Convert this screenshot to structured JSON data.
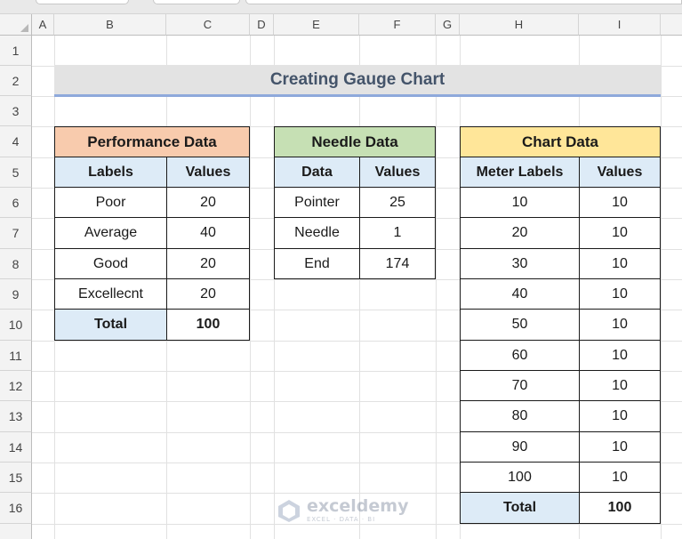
{
  "sheet": {
    "columns": [
      "A",
      "B",
      "C",
      "D",
      "E",
      "F",
      "G",
      "H",
      "I"
    ],
    "rows": [
      "1",
      "2",
      "3",
      "4",
      "5",
      "6",
      "7",
      "8",
      "9",
      "10",
      "11",
      "12",
      "13",
      "14",
      "15",
      "16"
    ]
  },
  "title": "Creating Gauge Chart",
  "performance": {
    "header": "Performance Data",
    "col_labels": "Labels",
    "col_values": "Values",
    "rows": [
      {
        "label": "Poor",
        "value": "20"
      },
      {
        "label": "Average",
        "value": "40"
      },
      {
        "label": "Good",
        "value": "20"
      },
      {
        "label": "Excellecnt",
        "value": "20"
      }
    ],
    "total_label": "Total",
    "total_value": "100"
  },
  "needle": {
    "header": "Needle Data",
    "col_data": "Data",
    "col_values": "Values",
    "rows": [
      {
        "label": "Pointer",
        "value": "25"
      },
      {
        "label": "Needle",
        "value": "1"
      },
      {
        "label": "End",
        "value": "174"
      }
    ]
  },
  "chart": {
    "header": "Chart Data",
    "col_meter": "Meter Labels",
    "col_values": "Values",
    "rows": [
      {
        "label": "10",
        "value": "10"
      },
      {
        "label": "20",
        "value": "10"
      },
      {
        "label": "30",
        "value": "10"
      },
      {
        "label": "40",
        "value": "10"
      },
      {
        "label": "50",
        "value": "10"
      },
      {
        "label": "60",
        "value": "10"
      },
      {
        "label": "70",
        "value": "10"
      },
      {
        "label": "80",
        "value": "10"
      },
      {
        "label": "90",
        "value": "10"
      },
      {
        "label": "100",
        "value": "10"
      }
    ],
    "total_label": "Total",
    "total_value": "100"
  },
  "watermark": {
    "brand": "exceldemy",
    "tagline": "EXCEL · DATA · BI"
  }
}
